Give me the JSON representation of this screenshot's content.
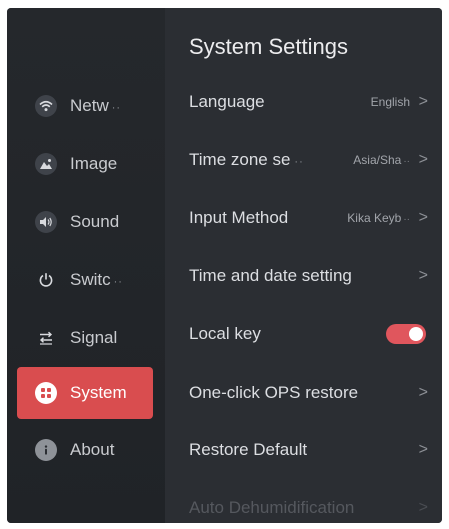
{
  "sidebar": {
    "items": [
      {
        "label": "Netw",
        "icon": "wifi-icon",
        "active": false,
        "truncated": true
      },
      {
        "label": "Image",
        "icon": "image-icon",
        "active": false,
        "truncated": false
      },
      {
        "label": "Sound",
        "icon": "speaker-icon",
        "active": false,
        "truncated": false
      },
      {
        "label": "Switc",
        "icon": "power-icon",
        "active": false,
        "truncated": true
      },
      {
        "label": "Signal",
        "icon": "signal-source-icon",
        "active": false,
        "truncated": false
      },
      {
        "label": "System",
        "icon": "grid-icon",
        "active": true,
        "truncated": false
      },
      {
        "label": "About",
        "icon": "info-icon",
        "active": false,
        "truncated": false
      }
    ],
    "ellipsis": "··"
  },
  "main": {
    "title": "System Settings",
    "rows": [
      {
        "label": "Language",
        "value": "English",
        "type": "link"
      },
      {
        "label": "Time zone se",
        "label_ellipsis": "··",
        "value": "Asia/Sha",
        "value_ellipsis": "··",
        "type": "link"
      },
      {
        "label": "Input Method",
        "value": "Kika Keyb",
        "value_ellipsis": "··",
        "type": "link"
      },
      {
        "label": "Time and date setting",
        "value": "",
        "type": "link"
      },
      {
        "label": "Local key",
        "value": "",
        "type": "toggle",
        "toggle_on": true
      },
      {
        "label": "One-click OPS restore",
        "value": "",
        "type": "link"
      },
      {
        "label": "Restore Default",
        "value": "",
        "type": "link"
      },
      {
        "label": "Auto Dehumidification",
        "value": "",
        "type": "link"
      }
    ],
    "chevron": ">"
  },
  "colors": {
    "accent": "#d94d4f",
    "toggle_on": "#e0565d",
    "panel_bg": "#2b2e33",
    "sidebar_bg": "#23262a"
  }
}
